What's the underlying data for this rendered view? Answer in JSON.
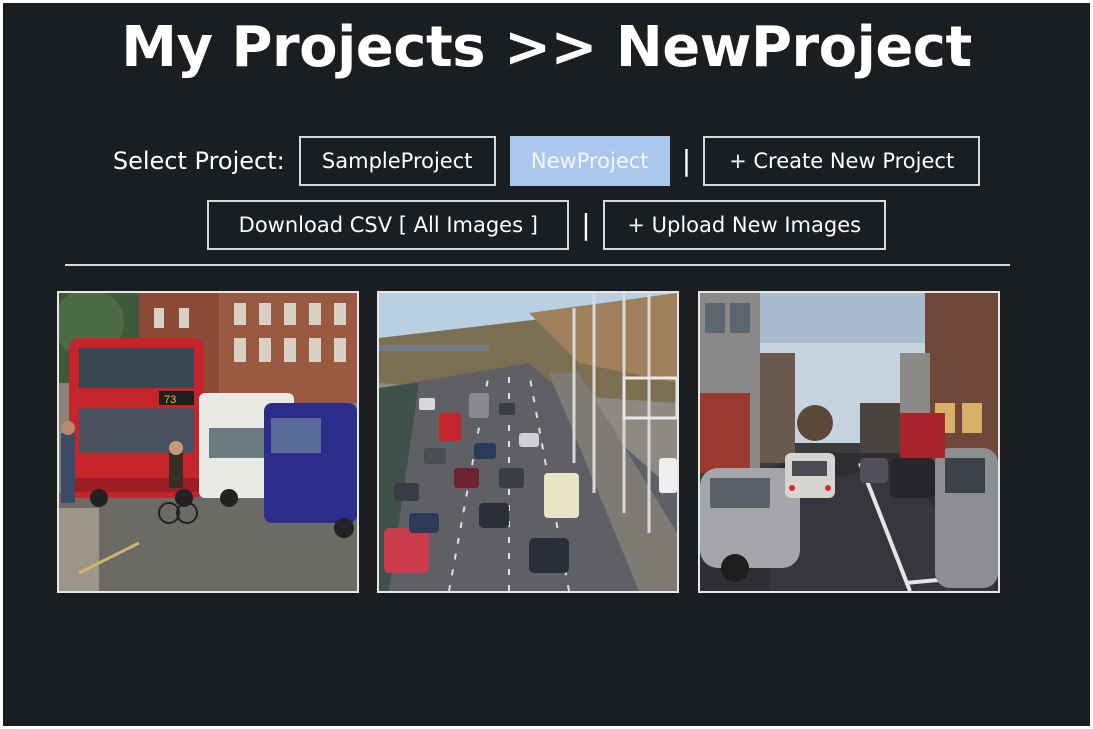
{
  "page": {
    "title": "My Projects >> NewProject"
  },
  "project_bar": {
    "label": "Select Project:",
    "projects": [
      "SampleProject",
      "NewProject"
    ],
    "active_project": "NewProject",
    "separator": "|",
    "create_label": "+ Create New Project"
  },
  "actions": {
    "download_label": "Download CSV [ All Images ]",
    "separator": "|",
    "upload_label": "+ Upload New Images"
  },
  "images": [
    {
      "scene": "street-with-red-double-decker-bus"
    },
    {
      "scene": "highway-with-traffic"
    },
    {
      "scene": "city-street-with-cars"
    }
  ],
  "colors": {
    "background": "#1a1e20",
    "active_button": "#a9c8ec",
    "button_border": "#d9d9d9"
  }
}
